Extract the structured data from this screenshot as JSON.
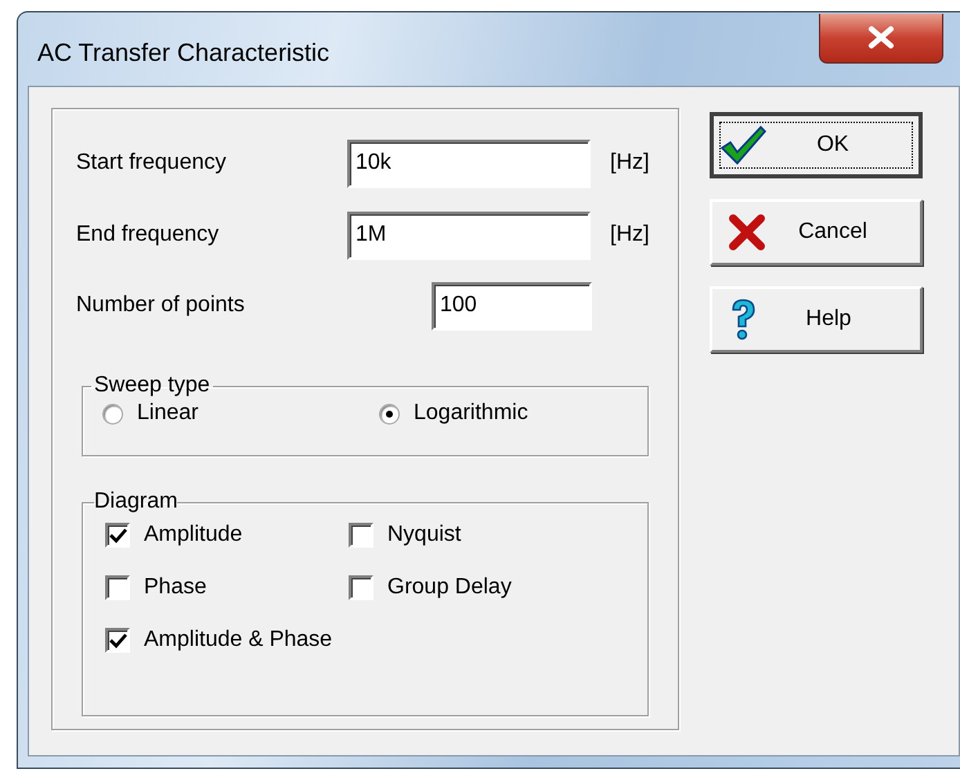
{
  "window": {
    "title": "AC Transfer Characteristic"
  },
  "fields": [
    {
      "label": "Start frequency",
      "value": "10k",
      "unit": "[Hz]",
      "kind": "wide"
    },
    {
      "label": "End frequency",
      "value": "1M",
      "unit": "[Hz]",
      "kind": "wide"
    },
    {
      "label": "Number of points",
      "value": "100",
      "kind": "narrow"
    }
  ],
  "sweep_type": {
    "title": "Sweep type",
    "options": [
      {
        "label": "Linear",
        "selected": false
      },
      {
        "label": "Logarithmic",
        "selected": true
      }
    ]
  },
  "diagram": {
    "title": "Diagram",
    "options": [
      {
        "label": "Amplitude",
        "checked": true
      },
      {
        "label": "Nyquist",
        "checked": false
      },
      {
        "label": "Phase",
        "checked": false
      },
      {
        "label": "Group Delay",
        "checked": false
      },
      {
        "label": "Amplitude & Phase",
        "checked": true
      }
    ]
  },
  "buttons": [
    {
      "label": "OK",
      "default": true
    },
    {
      "label": "Cancel",
      "default": false
    },
    {
      "label": "Help",
      "default": false
    }
  ]
}
